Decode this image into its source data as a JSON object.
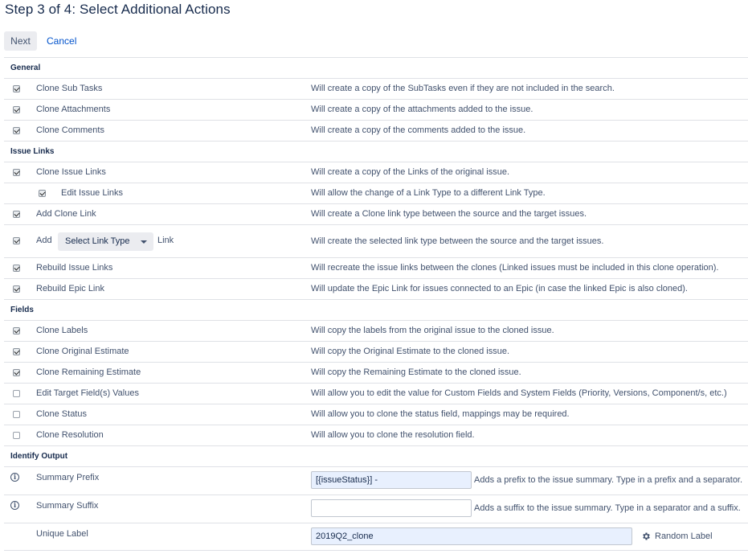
{
  "page": {
    "title": "Step 3 of 4: Select Additional Actions"
  },
  "toolbar": {
    "next_label": "Next",
    "cancel_label": "Cancel"
  },
  "sections": {
    "general": "General",
    "issue_links": "Issue Links",
    "fields": "Fields",
    "identify_output": "Identify Output"
  },
  "general": [
    {
      "label": "Clone Sub Tasks",
      "checked": true,
      "desc": "Will create a copy of the SubTasks even if they are not included in the search."
    },
    {
      "label": "Clone Attachments",
      "checked": true,
      "desc": "Will create a copy of the attachments added to the issue."
    },
    {
      "label": "Clone Comments",
      "checked": true,
      "desc": "Will create a copy of the comments added to the issue."
    }
  ],
  "issue_links": {
    "clone_issue_links": {
      "label": "Clone Issue Links",
      "checked": true,
      "desc": "Will create a copy of the Links of the original issue."
    },
    "edit_issue_links": {
      "label": "Edit Issue Links",
      "checked": true,
      "desc": "Will allow the change of a Link Type to a different Link Type."
    },
    "add_clone_link": {
      "label": "Add Clone Link",
      "checked": true,
      "desc": "Will create a Clone link type between the source and the target issues."
    },
    "add_link": {
      "label": "Add",
      "select_value": "Select Link Type",
      "suffix": "Link",
      "checked": true,
      "desc": "Will create the selected link type between the source and the target issues."
    },
    "rebuild_issue_links": {
      "label": "Rebuild Issue Links",
      "checked": true,
      "desc": "Will recreate the issue links between the clones (Linked issues must be included in this clone operation)."
    },
    "rebuild_epic_link": {
      "label": "Rebuild Epic Link",
      "checked": true,
      "desc": "Will update the Epic Link for issues connected to an Epic (in case the linked Epic is also cloned)."
    }
  },
  "fields": [
    {
      "label": "Clone Labels",
      "checked": true,
      "desc": "Will copy the labels from the original issue to the cloned issue."
    },
    {
      "label": "Clone Original Estimate",
      "checked": true,
      "desc": "Will copy the Original Estimate to the cloned issue."
    },
    {
      "label": "Clone Remaining Estimate",
      "checked": true,
      "desc": "Will copy the Remaining Estimate to the cloned issue."
    },
    {
      "label": "Edit Target Field(s) Values",
      "checked": false,
      "desc": "Will allow you to edit the value for Custom Fields and System Fields (Priority, Versions, Component/s, etc.)"
    },
    {
      "label": "Clone Status",
      "checked": false,
      "desc": "Will allow you to clone the status field, mappings may be required."
    },
    {
      "label": "Clone Resolution",
      "checked": false,
      "desc": "Will allow you to clone the resolution field."
    }
  ],
  "identify_output": {
    "summary_prefix": {
      "label": "Summary Prefix",
      "value": "[{issueStatus}] -",
      "desc": "Adds a prefix to the issue summary. Type in a prefix and a separator."
    },
    "summary_suffix": {
      "label": "Summary Suffix",
      "value": "",
      "desc": "Adds a suffix to the issue summary. Type in a separator and a suffix."
    },
    "unique_label": {
      "label": "Unique Label",
      "value": "2019Q2_clone",
      "random_label": "Random Label"
    }
  },
  "icons": {
    "info": "info-icon",
    "gear": "gear-icon",
    "caret": "chevron-down-icon"
  },
  "colors": {
    "link": "#0052cc",
    "text": "#42526e",
    "input_fill": "#e8f0fe"
  }
}
